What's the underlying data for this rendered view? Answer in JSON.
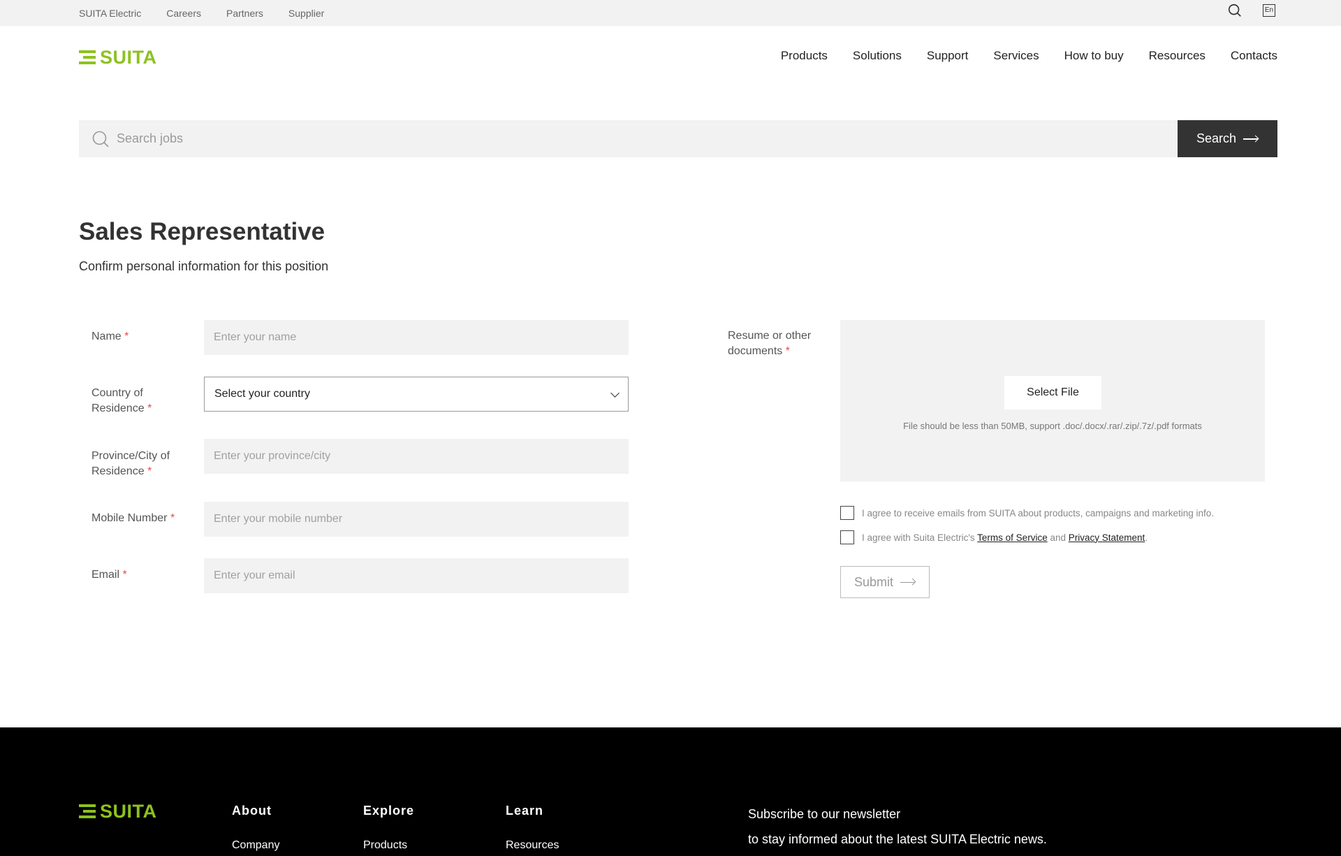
{
  "topbar": {
    "links": [
      "SUITA Electric",
      "Careers",
      "Partners",
      "Supplier"
    ],
    "lang": "En"
  },
  "brand": {
    "name": "SUITA",
    "color": "#8dc21f"
  },
  "nav": [
    "Products",
    "Solutions",
    "Support",
    "Services",
    "How to buy",
    "Resources",
    "Contacts"
  ],
  "search": {
    "placeholder": "Search jobs",
    "button_label": "Search"
  },
  "job": {
    "title": "Sales Representative",
    "subtitle": "Confirm personal information for this position"
  },
  "form": {
    "name": {
      "label": "Name",
      "placeholder": "Enter your name"
    },
    "country": {
      "label_line1": "Country of",
      "label_line2": "Residence",
      "value": "Select your country"
    },
    "province": {
      "label_line1": "Province/City of",
      "label_line2": "Residence",
      "placeholder": "Enter your province/city"
    },
    "mobile": {
      "label": "Mobile Number",
      "placeholder": "Enter your mobile number"
    },
    "email": {
      "label": "Email",
      "placeholder": "Enter your email"
    },
    "required_mark": "*",
    "resume": {
      "label_line1": "Resume or other",
      "label_line2": "documents",
      "button_label": "Select File",
      "hint": "File should be less than 50MB, support .doc/.docx/.rar/.zip/.7z/.pdf formats"
    },
    "consent_marketing": "I agree to receive emails from SUITA about products, campaigns and marketing info.",
    "consent_terms_prefix": "I agree with Suita Electric's",
    "terms_link": "Terms of Service",
    "and_text": "and",
    "privacy_link": "Privacy Statement",
    "terms_suffix": ".",
    "submit_label": "Submit"
  },
  "footer": {
    "columns": [
      {
        "title": "About",
        "first_link": "Company"
      },
      {
        "title": "Explore",
        "first_link": "Products"
      },
      {
        "title": "Learn",
        "first_link": "Resources"
      }
    ],
    "newsletter_line1": "Subscribe to our newsletter",
    "newsletter_line2": "to stay informed about the latest SUITA Electric news."
  },
  "colors": {
    "accent": "#8dc21f",
    "required": "#e84b4b",
    "dark_button": "#333333",
    "field_bg": "#f2f2f2"
  },
  "icons": [
    "search-icon",
    "language-icon",
    "chevron-down-icon",
    "arrow-right-icon"
  ]
}
